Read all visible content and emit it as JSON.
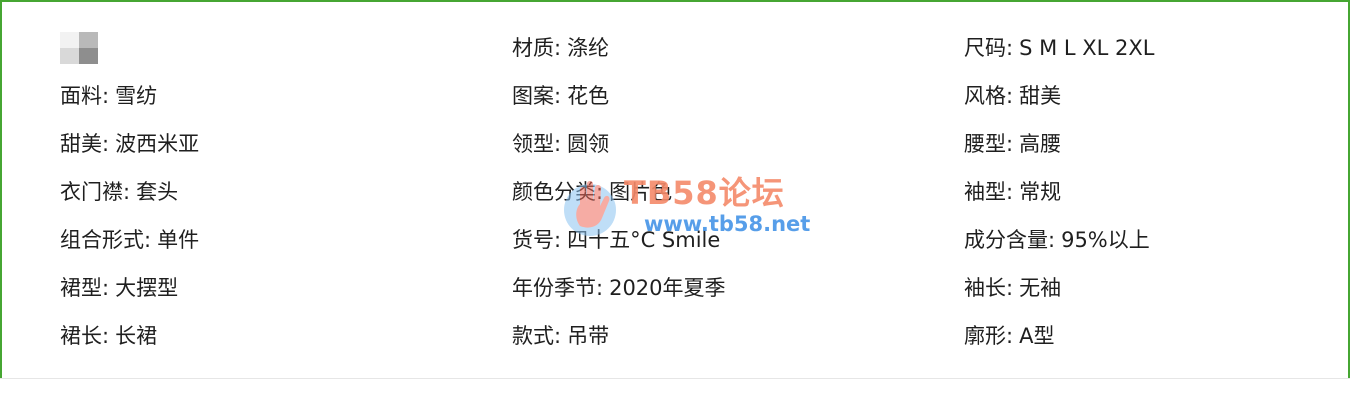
{
  "colors": {
    "frame_border": "#46a632",
    "divider": "#e6e6e6",
    "text": "#1f1f1f",
    "watermark_title": "#f58a6a",
    "watermark_url": "#3a8ee6"
  },
  "attributes": {
    "row1": {
      "col1": {
        "thumbnail": "product-thumbnail"
      },
      "col2": {
        "label": "材质:",
        "value": "涤纶"
      },
      "col3": {
        "label": "尺码:",
        "value": "S M L XL 2XL"
      }
    },
    "row2": {
      "col1": {
        "label": "面料:",
        "value": "雪纺"
      },
      "col2": {
        "label": "图案:",
        "value": "花色"
      },
      "col3": {
        "label": "风格:",
        "value": "甜美"
      }
    },
    "row3": {
      "col1": {
        "label": "甜美:",
        "value": "波西米亚"
      },
      "col2": {
        "label": "领型:",
        "value": "圆领"
      },
      "col3": {
        "label": "腰型:",
        "value": "高腰"
      }
    },
    "row4": {
      "col1": {
        "label": "衣门襟:",
        "value": "套头"
      },
      "col2": {
        "label": "颜色分类:",
        "value": "图片色"
      },
      "col3": {
        "label": "袖型:",
        "value": "常规"
      }
    },
    "row5": {
      "col1": {
        "label": "组合形式:",
        "value": "单件"
      },
      "col2": {
        "label": "货号:",
        "value": "四十五°C Smile"
      },
      "col3": {
        "label": "成分含量:",
        "value": "95%以上"
      }
    },
    "row6": {
      "col1": {
        "label": "裙型:",
        "value": "大摆型"
      },
      "col2": {
        "label": "年份季节:",
        "value": "2020年夏季"
      },
      "col3": {
        "label": "袖长:",
        "value": "无袖"
      }
    },
    "row7": {
      "col1": {
        "label": "裙长:",
        "value": "长裙"
      },
      "col2": {
        "label": "款式:",
        "value": "吊带"
      },
      "col3": {
        "label": "廓形:",
        "value": "A型"
      }
    }
  },
  "watermark": {
    "title": "TB58论坛",
    "url": "www.tb58.net",
    "icon": "hand-logo-icon"
  }
}
